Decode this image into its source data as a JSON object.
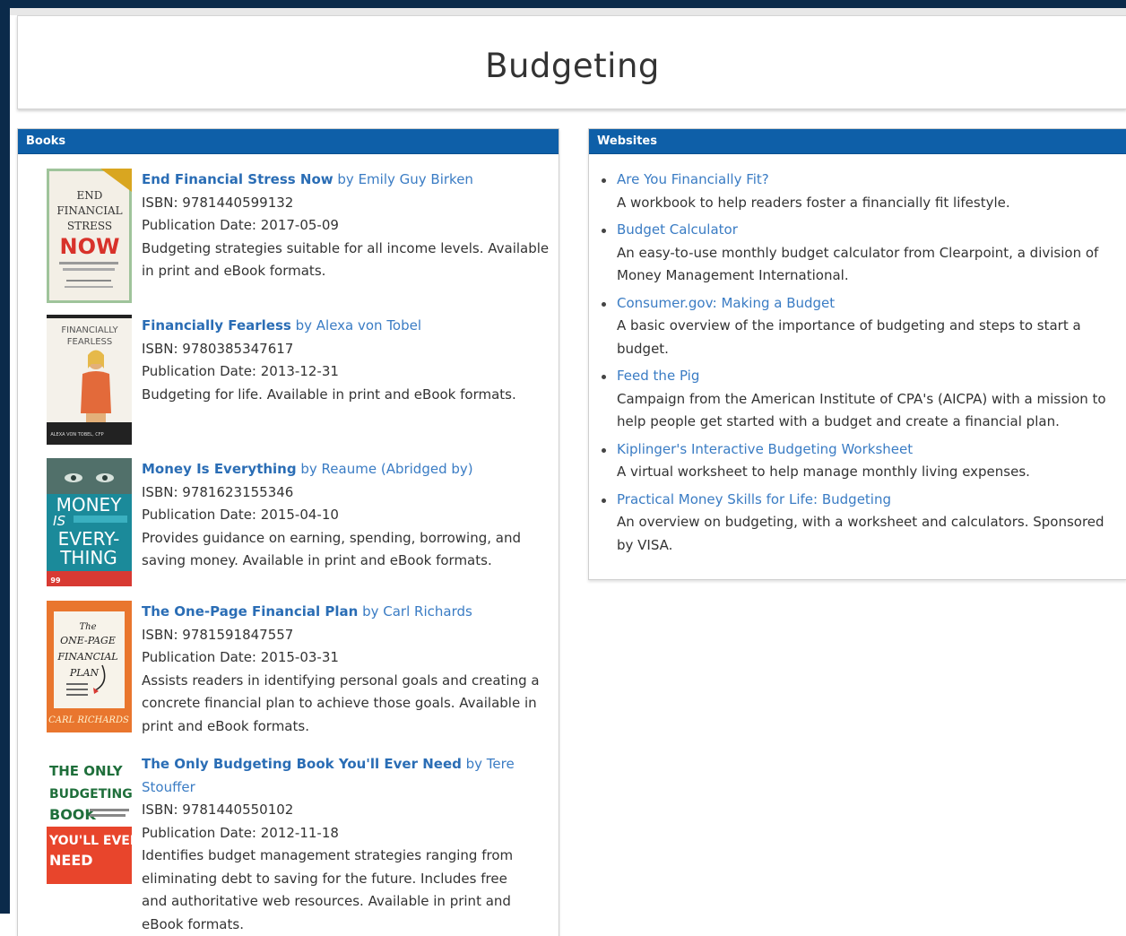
{
  "page": {
    "title": "Budgeting"
  },
  "books_panel": {
    "heading": "Books",
    "items": [
      {
        "title": "End Financial Stress Now",
        "by": "by Emily Guy Birken",
        "isbn": "ISBN: 9781440599132",
        "date": "Publication Date: 2017-05-09",
        "desc": "Budgeting strategies suitable for all income levels. Available in print and eBook formats.",
        "cover": {
          "l1": "END",
          "l2": "FINANCIAL",
          "l3": "STRESS",
          "l4": "NOW"
        }
      },
      {
        "title": "Financially Fearless",
        "by": "by Alexa von Tobel",
        "isbn": "ISBN: 9780385347617",
        "date": "Publication Date: 2013-12-31",
        "desc": "Budgeting for life. Available in print and eBook formats.",
        "cover": {
          "l1": "FINANCIALLY",
          "l2": "FEARLESS",
          "l3": "ALEXA VON TOBEL, CFP"
        }
      },
      {
        "title": "Money Is Everything",
        "by": "by Reaume (Abridged by)",
        "isbn": "ISBN: 9781623155346",
        "date": "Publication Date: 2015-04-10",
        "desc": "Provides guidance on earning, spending, borrowing, and saving money. Available in print and eBook formats.",
        "cover": {
          "l1": "MONEY",
          "l2": "IS",
          "l3": "EVERY-",
          "l4": "THING",
          "l5": "99"
        }
      },
      {
        "title": "The One-Page Financial Plan",
        "by": "by Carl Richards",
        "isbn": "ISBN: 9781591847557",
        "date": "Publication Date: 2015-03-31",
        "desc": "Assists readers in identifying personal goals and creating a concrete financial plan to achieve those goals. Available in print and eBook formats.",
        "cover": {
          "l1": "The",
          "l2": "ONE-PAGE",
          "l3": "FINANCIAL",
          "l4": "PLAN",
          "l5": "CARL RICHARDS"
        }
      },
      {
        "title": "The Only Budgeting Book You'll Ever Need",
        "by": "by Tere Stouffer",
        "isbn": "ISBN: 9781440550102",
        "date": "Publication Date: 2012-11-18",
        "desc": "Identifies budget management strategies ranging from eliminating debt to saving for the future. Includes free and authoritative web resources. Available in print and eBook formats.",
        "cover": {
          "l1": "THE ONLY",
          "l2": "BUDGETING",
          "l3": "BOOK",
          "l4": "YOU'LL EVER",
          "l5": "NEED"
        }
      }
    ]
  },
  "websites_panel": {
    "heading": "Websites",
    "items": [
      {
        "link": "Are You Financially Fit?",
        "desc": "A workbook to help readers foster a financially fit lifestyle."
      },
      {
        "link": "Budget Calculator",
        "desc": "An easy-to-use monthly budget calculator from Clearpoint, a division of Money Management International."
      },
      {
        "link": "Consumer.gov: Making a Budget",
        "desc": "A basic overview of the importance of budgeting and steps to start a budget."
      },
      {
        "link": "Feed the Pig",
        "desc": "Campaign from the American Institute of CPA's (AICPA) with a mission to help people get started with a budget and create a financial plan."
      },
      {
        "link": "Kiplinger's Interactive Budgeting Worksheet",
        "desc": "A virtual worksheet to help manage monthly living expenses."
      },
      {
        "link": "Practical Money Skills for Life: Budgeting",
        "desc": "An overview on budgeting, with a worksheet and calculators. Sponsored by VISA."
      }
    ]
  },
  "colors": {
    "frame": "#0b2a4a",
    "panel_header": "#0e5fa8",
    "link": "#2a6db5"
  }
}
